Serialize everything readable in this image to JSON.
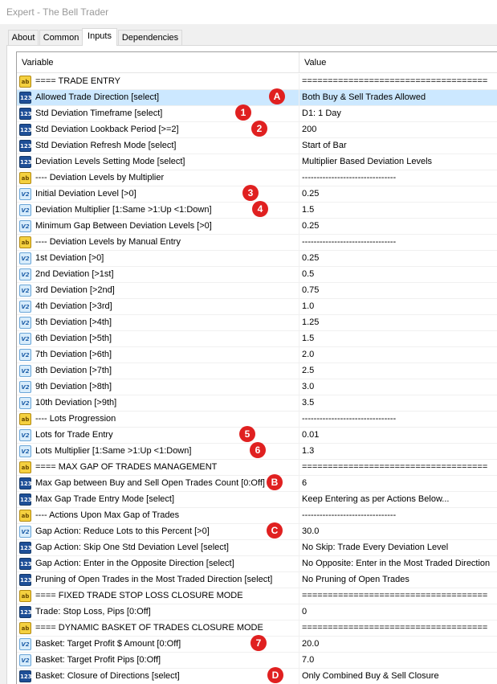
{
  "window": {
    "title": "Expert - The Bell Trader"
  },
  "tabs": [
    "About",
    "Common",
    "Inputs",
    "Dependencies"
  ],
  "active_tab": "Inputs",
  "columns": {
    "variable": "Variable",
    "value": "Value"
  },
  "rows": [
    {
      "type": "ab",
      "name": "==== TRADE ENTRY",
      "value": "===================================="
    },
    {
      "type": "123",
      "name": "Allowed Trade Direction [select]",
      "value": "Both Buy & Sell Trades Allowed",
      "selected": true
    },
    {
      "type": "123",
      "name": "Std Deviation Timeframe [select]",
      "value": "D1:      1 Day"
    },
    {
      "type": "123",
      "name": "Std Deviation Lookback Period [>=2]",
      "value": "200"
    },
    {
      "type": "123",
      "name": "Std Deviation Refresh Mode [select]",
      "value": "Start of Bar"
    },
    {
      "type": "123",
      "name": "Deviation Levels Setting Mode [select]",
      "value": "Multiplier Based Deviation Levels"
    },
    {
      "type": "ab",
      "name": "---- Deviation Levels by Multiplier",
      "value": "--------------------------------"
    },
    {
      "type": "v2",
      "name": "Initial Deviation Level [>0]",
      "value": "0.25"
    },
    {
      "type": "v2",
      "name": "Deviation Multiplier [1:Same >1:Up <1:Down]",
      "value": "1.5"
    },
    {
      "type": "v2",
      "name": "Minimum Gap Between Deviation Levels [>0]",
      "value": "0.25"
    },
    {
      "type": "ab",
      "name": "---- Deviation Levels by Manual Entry",
      "value": "--------------------------------"
    },
    {
      "type": "v2",
      "name": "1st Deviation [>0]",
      "value": "0.25"
    },
    {
      "type": "v2",
      "name": "2nd Deviation [>1st]",
      "value": "0.5"
    },
    {
      "type": "v2",
      "name": "3rd Deviation [>2nd]",
      "value": "0.75"
    },
    {
      "type": "v2",
      "name": "4th Deviation [>3rd]",
      "value": "1.0"
    },
    {
      "type": "v2",
      "name": "5th Deviation [>4th]",
      "value": "1.25"
    },
    {
      "type": "v2",
      "name": "6th Deviation [>5th]",
      "value": "1.5"
    },
    {
      "type": "v2",
      "name": "7th Deviation [>6th]",
      "value": "2.0"
    },
    {
      "type": "v2",
      "name": "8th Deviation [>7th]",
      "value": "2.5"
    },
    {
      "type": "v2",
      "name": "9th Deviation [>8th]",
      "value": "3.0"
    },
    {
      "type": "v2",
      "name": "10th Deviation [>9th]",
      "value": "3.5"
    },
    {
      "type": "ab",
      "name": "---- Lots Progression",
      "value": "--------------------------------"
    },
    {
      "type": "v2",
      "name": "Lots for Trade Entry",
      "value": "0.01"
    },
    {
      "type": "v2",
      "name": "Lots Multiplier [1:Same >1:Up <1:Down]",
      "value": "1.3"
    },
    {
      "type": "ab",
      "name": "==== MAX GAP OF TRADES MANAGEMENT",
      "value": "===================================="
    },
    {
      "type": "123",
      "name": "Max Gap between Buy and Sell Open Trades Count [0:Off]",
      "value": "6"
    },
    {
      "type": "123",
      "name": "Max Gap Trade Entry Mode [select]",
      "value": "Keep Entering as per Actions Below..."
    },
    {
      "type": "ab",
      "name": "---- Actions Upon Max Gap of Trades",
      "value": "--------------------------------"
    },
    {
      "type": "v2",
      "name": "Gap Action: Reduce Lots to this Percent [>0]",
      "value": "30.0"
    },
    {
      "type": "123",
      "name": "Gap Action: Skip One Std Deviation Level [select]",
      "value": "No Skip: Trade Every Deviation Level"
    },
    {
      "type": "123",
      "name": "Gap Action: Enter in the Opposite Direction [select]",
      "value": "No Opposite: Enter in the Most Traded Direction"
    },
    {
      "type": "123",
      "name": "Pruning of Open Trades in the Most Traded Direction [select]",
      "value": "No Pruning of Open Trades"
    },
    {
      "type": "ab",
      "name": "==== FIXED TRADE STOP LOSS CLOSURE MODE",
      "value": "===================================="
    },
    {
      "type": "123",
      "name": "Trade: Stop Loss, Pips [0:Off]",
      "value": "0"
    },
    {
      "type": "ab",
      "name": "==== DYNAMIC BASKET OF TRADES CLOSURE MODE",
      "value": "===================================="
    },
    {
      "type": "v2",
      "name": "Basket: Target Profit $ Amount [0:Off]",
      "value": "20.0"
    },
    {
      "type": "v2",
      "name": "Basket: Target Profit Pips [0:Off]",
      "value": "7.0"
    },
    {
      "type": "123",
      "name": "Basket: Closure of Directions [select]",
      "value": "Only Combined Buy & Sell Closure"
    }
  ],
  "markers": [
    {
      "label": "A",
      "row": 1
    },
    {
      "label": "1",
      "row": 2
    },
    {
      "label": "2",
      "row": 3
    },
    {
      "label": "3",
      "row": 7
    },
    {
      "label": "4",
      "row": 8
    },
    {
      "label": "5",
      "row": 22
    },
    {
      "label": "6",
      "row": 23
    },
    {
      "label": "B",
      "row": 25
    },
    {
      "label": "C",
      "row": 28
    },
    {
      "label": "7",
      "row": 35
    },
    {
      "label": "D",
      "row": 37
    }
  ],
  "icons": {
    "ab": "string-param-icon",
    "123": "integer-param-icon",
    "v2": "double-param-icon"
  },
  "colors": {
    "selected_row": "#cce8ff",
    "marker": "#e02020"
  }
}
